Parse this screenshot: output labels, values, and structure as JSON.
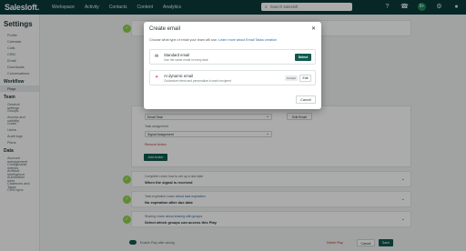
{
  "topnav": {
    "logo": "Salesloft.",
    "links": [
      "Workspace",
      "Activity",
      "Contacts",
      "Content",
      "Analytics"
    ],
    "search_placeholder": "Search Salesloft",
    "notification_count": "9+"
  },
  "sidebar": {
    "title": "Settings",
    "items_top": [
      "Profile",
      "Calendar",
      "Calls",
      "CRM",
      "Email",
      "Downloads",
      "Conversations"
    ],
    "workflow_label": "Workflow",
    "workflow_items": [
      "Plays"
    ],
    "team_label": "Team",
    "team_items": [
      "General settings",
      "Groups",
      "Access and visibility",
      "Goals",
      "Users",
      "Audit logs",
      "Plans"
    ],
    "data_label": "Data",
    "data_items": [
      "Account management",
      "Configurable metrics",
      "Artificial Intelligence",
      "Automation rules",
      "Cadences and Tasks",
      "CRM sync"
    ]
  },
  "background": {
    "email_task_select": "Email Task",
    "edit_email": "Edit Email",
    "task_assignment_label": "Task assignment",
    "signal_assignment": "Signal Assignment",
    "remove_action": "Remove Action",
    "add_action": "Add Action",
    "row1_label": "Complete Learn how to set up a due date",
    "row1_value": "When the signal is received",
    "row2_label_prefix": "Task expiration",
    "row2_label_link": "Learn about task expiration",
    "row2_value": "No expiration after due date",
    "row3_label_prefix": "Sharing",
    "row3_label_link": "Learn about sharing with groups",
    "row3_value": "Select which groups can access this Play",
    "toggle_label": "Enable Play after saving",
    "delete_play": "Delete Play",
    "cancel": "Cancel",
    "save": "Save"
  },
  "modal": {
    "title": "Create email",
    "description": "Choose what type of email your team will use.",
    "description_link": "Learn more about Email Tasks creation",
    "options": [
      {
        "title": "Standard email",
        "subtitle": "Use the same email in every task",
        "action": "Select"
      },
      {
        "title": "AI dynamic email",
        "subtitle": "Customize intent and personalize to each recipient",
        "badge": "Current",
        "action": "Edit"
      }
    ],
    "cancel": "Cancel"
  },
  "colors": {
    "nav_bg": "#0b3b3b",
    "primary_button": "#0f5a4c",
    "check_green": "#8bd04a",
    "link": "#2b6aa6",
    "danger": "#c0392b"
  }
}
